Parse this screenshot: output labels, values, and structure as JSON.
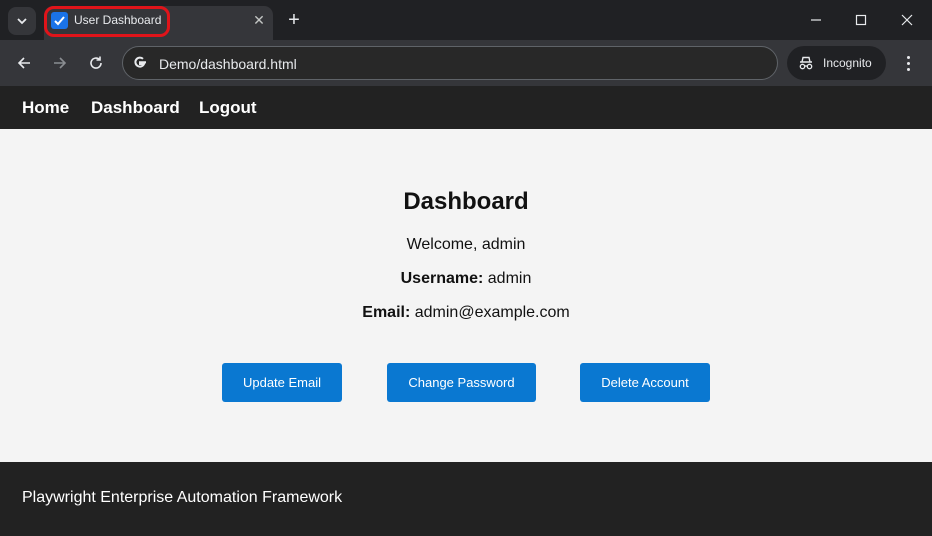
{
  "browser": {
    "tab": {
      "title": "User Dashboard",
      "close_glyph": "✕"
    },
    "new_tab_glyph": "+",
    "address": {
      "url": "Demo/dashboard.html"
    },
    "incognito_label": "Incognito"
  },
  "nav": {
    "home": "Home",
    "dashboard": "Dashboard",
    "logout": "Logout"
  },
  "main": {
    "title": "Dashboard",
    "welcome": "Welcome, admin",
    "username_label": "Username:",
    "username_value": "admin",
    "email_label": "Email:",
    "email_value": "admin@example.com"
  },
  "actions": {
    "update_email": "Update Email",
    "change_password": "Change Password",
    "delete_account": "Delete Account"
  },
  "footer": {
    "text": "Playwright Enterprise Automation Framework"
  },
  "colors": {
    "accent_button": "#0a78d1",
    "nav_background": "#222222",
    "tab_highlight": "#e0141a"
  },
  "icons": [
    "tab-search-icon",
    "checkbox-favicon-icon",
    "close-icon",
    "plus-icon",
    "minimize-icon",
    "maximize-icon",
    "window-close-icon",
    "back-icon",
    "forward-icon",
    "reload-icon",
    "google-icon",
    "incognito-icon",
    "more-menu-icon"
  ]
}
